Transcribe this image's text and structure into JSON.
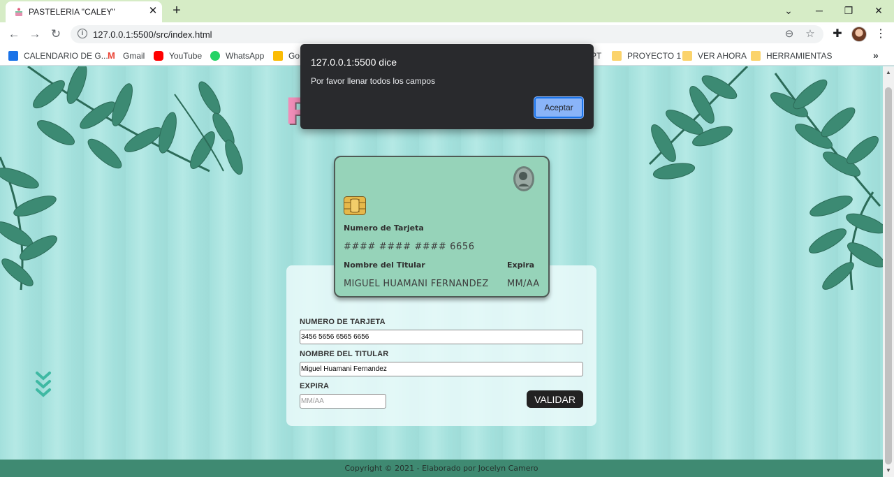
{
  "browser": {
    "tab_title": "PASTELERIA \"CALEY\"",
    "url": "127.0.0.1:5500/src/index.html",
    "bookmarks": [
      {
        "label": "CALENDARIO DE G...",
        "icon": "calendar-icon",
        "color": "#1a73e8"
      },
      {
        "label": "Gmail",
        "icon": "gmail-icon",
        "color": "#ea4335"
      },
      {
        "label": "YouTube",
        "icon": "youtube-icon",
        "color": "#ff0000"
      },
      {
        "label": "WhatsApp",
        "icon": "whatsapp-icon",
        "color": "#25d366"
      },
      {
        "label": "Go",
        "icon": "keep-icon",
        "color": "#fbbc04"
      },
      {
        "label": "PT",
        "icon": "folder-icon",
        "color": "#fbd36b"
      },
      {
        "label": "PROYECTO 1",
        "icon": "folder-icon",
        "color": "#fbd36b"
      },
      {
        "label": "VER AHORA",
        "icon": "folder-icon",
        "color": "#fbd36b"
      },
      {
        "label": "HERRAMIENTAS",
        "icon": "folder-icon",
        "color": "#fbd36b"
      }
    ],
    "more_bookmarks": "»"
  },
  "page": {
    "title_fragment": "P",
    "card": {
      "number_label": "Numero de Tarjeta",
      "number_value": "#### #### #### 6656",
      "holder_label": "Nombre del Titular",
      "holder_value": "MIGUEL HUAMANI FERNANDEZ",
      "expiry_label": "Expira",
      "expiry_value": "MM/AA",
      "color": "#96d3b9"
    },
    "form": {
      "number_label": "NUMERO DE TARJETA",
      "number_value": "3456 5656 6565 6656",
      "holder_label": "NOMBRE DEL TITULAR",
      "holder_value": "Miguel Huamani Fernandez",
      "expiry_label": "EXPIRA",
      "expiry_placeholder": "MM/AA",
      "validate_label": "VALIDAR"
    },
    "footer": "Copyright © 2021 - Elaborado por Jocelyn Camero"
  },
  "dialog": {
    "title": "127.0.0.1:5500 dice",
    "message": "Por favor llenar todos los campos",
    "accept_label": "Aceptar"
  },
  "colors": {
    "tabstrip": "#d6ecc6",
    "page_background": "#a9e3e0",
    "footer": "#3f8a72",
    "accent_pink": "#f08db8",
    "dialog_button": "#8ab4f8"
  }
}
